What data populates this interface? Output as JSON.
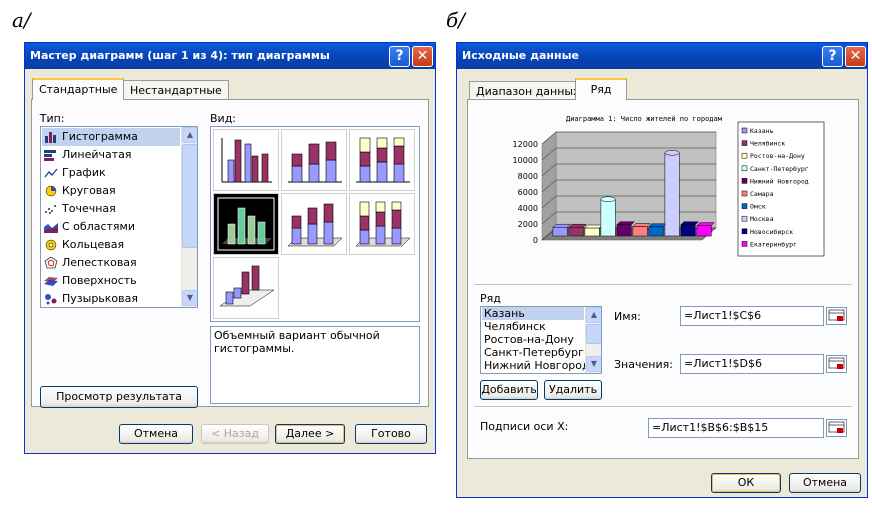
{
  "captions": {
    "a": "а/",
    "b": "б/"
  },
  "wizard": {
    "title": "Мастер диаграмм (шаг 1 из 4): тип диаграммы",
    "tabs": [
      "Стандартные",
      "Нестандартные"
    ],
    "type_label": "Тип:",
    "view_label": "Вид:",
    "chart_types": [
      {
        "label": "Гистограмма",
        "icon": "column-chart-icon",
        "selected": true
      },
      {
        "label": "Линейчатая",
        "icon": "bar-chart-icon"
      },
      {
        "label": "График",
        "icon": "line-chart-icon"
      },
      {
        "label": "Круговая",
        "icon": "pie-chart-icon"
      },
      {
        "label": "Точечная",
        "icon": "scatter-chart-icon"
      },
      {
        "label": "С областями",
        "icon": "area-chart-icon"
      },
      {
        "label": "Кольцевая",
        "icon": "doughnut-chart-icon"
      },
      {
        "label": "Лепестковая",
        "icon": "radar-chart-icon"
      },
      {
        "label": "Поверхность",
        "icon": "surface-chart-icon"
      },
      {
        "label": "Пузырьковая",
        "icon": "bubble-chart-icon"
      }
    ],
    "description": "Объемный вариант обычной гистограммы.",
    "preview_button": "Просмотр результата",
    "buttons": {
      "cancel": "Отмена",
      "back": "< Назад",
      "next": "Далее >",
      "finish": "Готово"
    }
  },
  "source": {
    "title": "Исходные данные",
    "tabs": [
      "Диапазон данных",
      "Ряд"
    ],
    "series_label": "Ряд",
    "series_list": [
      "Казань",
      "Челябинск",
      "Ростов-на-Дону",
      "Санкт-Петербург",
      "Нижний Новгород"
    ],
    "add_button": "Добавить",
    "remove_button": "Удалить",
    "name_label": "Имя:",
    "name_value": "=Лист1!$C$6",
    "values_label": "Значения:",
    "values_value": "=Лист1!$D$6",
    "xlabels_label": "Подписи оси X:",
    "xlabels_value": "=Лист1!$B$6:$B$15",
    "ok": "ОК",
    "cancel": "Отмена"
  },
  "chart_data": {
    "type": "bar",
    "title": "Диаграмма 1: Число жителей по городам",
    "ylim": [
      0,
      12000
    ],
    "yticks": [
      "0",
      "2000",
      "4000",
      "6000",
      "8000",
      "10000",
      "12000"
    ],
    "series": [
      {
        "name": "Казань",
        "value": 1100,
        "color": "#9999ff"
      },
      {
        "name": "Челябинск",
        "value": 1100,
        "color": "#993366"
      },
      {
        "name": "Ростов-на-Дону",
        "value": 1000,
        "color": "#ffffcc"
      },
      {
        "name": "Санкт-Петербург",
        "value": 4600,
        "color": "#ccffff"
      },
      {
        "name": "Нижний Новгород",
        "value": 1400,
        "color": "#660066"
      },
      {
        "name": "Самара",
        "value": 1200,
        "color": "#ff8080"
      },
      {
        "name": "Омск",
        "value": 1150,
        "color": "#0066cc"
      },
      {
        "name": "Москва",
        "value": 10400,
        "color": "#ccccff"
      },
      {
        "name": "Новосибирск",
        "value": 1400,
        "color": "#000080"
      },
      {
        "name": "Екатеринбург",
        "value": 1300,
        "color": "#ff00ff"
      }
    ]
  }
}
